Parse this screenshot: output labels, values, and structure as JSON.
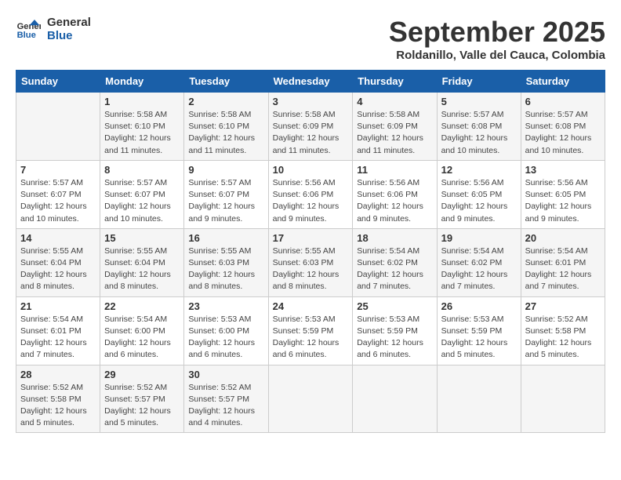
{
  "logo": {
    "line1": "General",
    "line2": "Blue"
  },
  "title": "September 2025",
  "location": "Roldanillo, Valle del Cauca, Colombia",
  "days_of_week": [
    "Sunday",
    "Monday",
    "Tuesday",
    "Wednesday",
    "Thursday",
    "Friday",
    "Saturday"
  ],
  "weeks": [
    [
      {
        "day": "",
        "info": ""
      },
      {
        "day": "1",
        "info": "Sunrise: 5:58 AM\nSunset: 6:10 PM\nDaylight: 12 hours\nand 11 minutes."
      },
      {
        "day": "2",
        "info": "Sunrise: 5:58 AM\nSunset: 6:10 PM\nDaylight: 12 hours\nand 11 minutes."
      },
      {
        "day": "3",
        "info": "Sunrise: 5:58 AM\nSunset: 6:09 PM\nDaylight: 12 hours\nand 11 minutes."
      },
      {
        "day": "4",
        "info": "Sunrise: 5:58 AM\nSunset: 6:09 PM\nDaylight: 12 hours\nand 11 minutes."
      },
      {
        "day": "5",
        "info": "Sunrise: 5:57 AM\nSunset: 6:08 PM\nDaylight: 12 hours\nand 10 minutes."
      },
      {
        "day": "6",
        "info": "Sunrise: 5:57 AM\nSunset: 6:08 PM\nDaylight: 12 hours\nand 10 minutes."
      }
    ],
    [
      {
        "day": "7",
        "info": "Sunrise: 5:57 AM\nSunset: 6:07 PM\nDaylight: 12 hours\nand 10 minutes."
      },
      {
        "day": "8",
        "info": "Sunrise: 5:57 AM\nSunset: 6:07 PM\nDaylight: 12 hours\nand 10 minutes."
      },
      {
        "day": "9",
        "info": "Sunrise: 5:57 AM\nSunset: 6:07 PM\nDaylight: 12 hours\nand 9 minutes."
      },
      {
        "day": "10",
        "info": "Sunrise: 5:56 AM\nSunset: 6:06 PM\nDaylight: 12 hours\nand 9 minutes."
      },
      {
        "day": "11",
        "info": "Sunrise: 5:56 AM\nSunset: 6:06 PM\nDaylight: 12 hours\nand 9 minutes."
      },
      {
        "day": "12",
        "info": "Sunrise: 5:56 AM\nSunset: 6:05 PM\nDaylight: 12 hours\nand 9 minutes."
      },
      {
        "day": "13",
        "info": "Sunrise: 5:56 AM\nSunset: 6:05 PM\nDaylight: 12 hours\nand 9 minutes."
      }
    ],
    [
      {
        "day": "14",
        "info": "Sunrise: 5:55 AM\nSunset: 6:04 PM\nDaylight: 12 hours\nand 8 minutes."
      },
      {
        "day": "15",
        "info": "Sunrise: 5:55 AM\nSunset: 6:04 PM\nDaylight: 12 hours\nand 8 minutes."
      },
      {
        "day": "16",
        "info": "Sunrise: 5:55 AM\nSunset: 6:03 PM\nDaylight: 12 hours\nand 8 minutes."
      },
      {
        "day": "17",
        "info": "Sunrise: 5:55 AM\nSunset: 6:03 PM\nDaylight: 12 hours\nand 8 minutes."
      },
      {
        "day": "18",
        "info": "Sunrise: 5:54 AM\nSunset: 6:02 PM\nDaylight: 12 hours\nand 7 minutes."
      },
      {
        "day": "19",
        "info": "Sunrise: 5:54 AM\nSunset: 6:02 PM\nDaylight: 12 hours\nand 7 minutes."
      },
      {
        "day": "20",
        "info": "Sunrise: 5:54 AM\nSunset: 6:01 PM\nDaylight: 12 hours\nand 7 minutes."
      }
    ],
    [
      {
        "day": "21",
        "info": "Sunrise: 5:54 AM\nSunset: 6:01 PM\nDaylight: 12 hours\nand 7 minutes."
      },
      {
        "day": "22",
        "info": "Sunrise: 5:54 AM\nSunset: 6:00 PM\nDaylight: 12 hours\nand 6 minutes."
      },
      {
        "day": "23",
        "info": "Sunrise: 5:53 AM\nSunset: 6:00 PM\nDaylight: 12 hours\nand 6 minutes."
      },
      {
        "day": "24",
        "info": "Sunrise: 5:53 AM\nSunset: 5:59 PM\nDaylight: 12 hours\nand 6 minutes."
      },
      {
        "day": "25",
        "info": "Sunrise: 5:53 AM\nSunset: 5:59 PM\nDaylight: 12 hours\nand 6 minutes."
      },
      {
        "day": "26",
        "info": "Sunrise: 5:53 AM\nSunset: 5:59 PM\nDaylight: 12 hours\nand 5 minutes."
      },
      {
        "day": "27",
        "info": "Sunrise: 5:52 AM\nSunset: 5:58 PM\nDaylight: 12 hours\nand 5 minutes."
      }
    ],
    [
      {
        "day": "28",
        "info": "Sunrise: 5:52 AM\nSunset: 5:58 PM\nDaylight: 12 hours\nand 5 minutes."
      },
      {
        "day": "29",
        "info": "Sunrise: 5:52 AM\nSunset: 5:57 PM\nDaylight: 12 hours\nand 5 minutes."
      },
      {
        "day": "30",
        "info": "Sunrise: 5:52 AM\nSunset: 5:57 PM\nDaylight: 12 hours\nand 4 minutes."
      },
      {
        "day": "",
        "info": ""
      },
      {
        "day": "",
        "info": ""
      },
      {
        "day": "",
        "info": ""
      },
      {
        "day": "",
        "info": ""
      }
    ]
  ]
}
